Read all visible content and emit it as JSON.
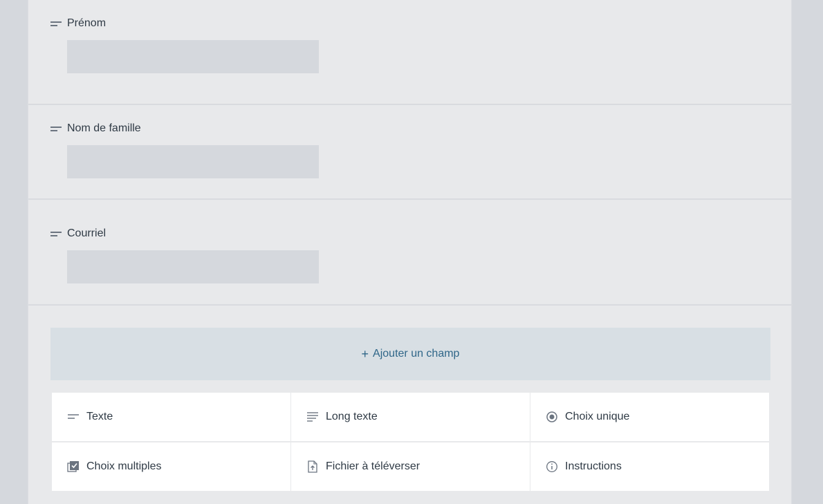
{
  "form": {
    "fields": [
      {
        "label": "Prénom",
        "value": ""
      },
      {
        "label": "Nom de famille",
        "value": ""
      },
      {
        "label": "Courriel",
        "value": ""
      }
    ],
    "add_field": {
      "icon": "+",
      "label": "Ajouter un champ"
    },
    "field_types": [
      {
        "icon": "short-text-icon",
        "label": "Texte"
      },
      {
        "icon": "long-text-icon",
        "label": "Long texte"
      },
      {
        "icon": "radio-icon",
        "label": "Choix unique"
      },
      {
        "icon": "checkbox-icon",
        "label": "Choix multiples"
      },
      {
        "icon": "file-upload-icon",
        "label": "Fichier à téléverser"
      },
      {
        "icon": "info-icon",
        "label": "Instructions"
      }
    ]
  },
  "colors": {
    "background": "#d5d8dd",
    "panel": "#e8e9eb",
    "add_field_bg": "#d8dfe4",
    "accent": "#2f6688",
    "text": "#2f3a45"
  }
}
